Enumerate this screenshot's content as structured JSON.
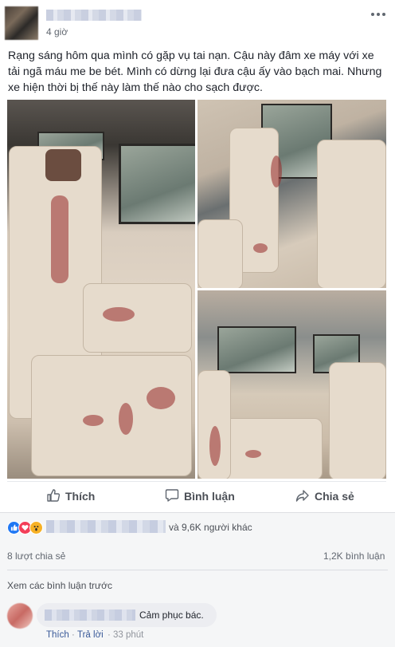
{
  "post": {
    "time": "4 giờ",
    "text": "Rạng sáng hôm qua mình có gặp vụ tai nạn. Cậu này đâm xe máy với xe tải ngã máu me be bét. Mình có dừng lại đưa cậu ấy vào bạch mai. Nhưng xe hiện thời bị thế này làm thế nào cho sạch được."
  },
  "actions": {
    "like": "Thích",
    "comment": "Bình luận",
    "share": "Chia sẻ"
  },
  "reactions": {
    "others": "và 9,6K người khác",
    "shares": "8 lượt chia sẻ",
    "comments": "1,2K bình luận",
    "colors": {
      "like": "#2078f4",
      "love": "#f33e58",
      "wow": "#f7b125"
    }
  },
  "comments": {
    "view_previous": "Xem các bình luận trước",
    "items": [
      {
        "text": "Cảm phục bác.",
        "like": "Thích",
        "reply": "Trả lời",
        "time": "33 phút"
      }
    ]
  },
  "icons": [
    "more-options-icon",
    "globe-icon",
    "like-icon",
    "comment-icon",
    "share-icon",
    "like-reaction-icon",
    "love-reaction-icon",
    "wow-reaction-icon"
  ]
}
